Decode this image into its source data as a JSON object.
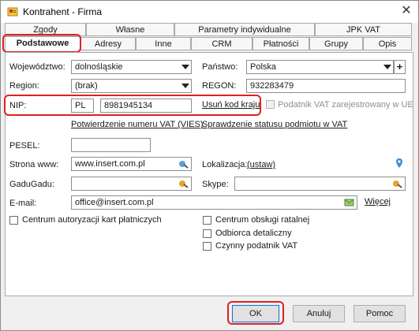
{
  "window": {
    "title": "Kontrahent - Firma"
  },
  "tabs_top": [
    {
      "label": "Zgody"
    },
    {
      "label": "Własne"
    },
    {
      "label": "Parametry indywidualne"
    },
    {
      "label": "JPK VAT"
    }
  ],
  "tabs_bottom": [
    {
      "label": "Podstawowe",
      "active": true
    },
    {
      "label": "Adresy"
    },
    {
      "label": "Inne"
    },
    {
      "label": "CRM"
    },
    {
      "label": "Płatności"
    },
    {
      "label": "Grupy"
    },
    {
      "label": "Opis"
    }
  ],
  "form": {
    "wojewodztwo_label": "Województwo:",
    "wojewodztwo_value": "dolnośląskie",
    "panstwo_label": "Państwo:",
    "panstwo_value": "Polska",
    "panstwo_add": "+",
    "region_label": "Region:",
    "region_value": "(brak)",
    "regon_label": "REGON:",
    "regon_value": "932283479",
    "nip_label": "NIP:",
    "nip_prefix": "PL",
    "nip_value": "8981945134",
    "usun_kod_kraju": "Usuń kod kraju",
    "podatnik_vat_ue": "Podatnik VAT zarejestrowany w UE",
    "potwierdzenie_vies": "Potwierdzenie numeru VAT (VIES)",
    "sprawdzenie_vat": "Sprawdzenie statusu podmiotu w VAT",
    "pesel_label": "PESEL:",
    "pesel_value": "",
    "strona_label": "Strona www:",
    "strona_value": "www.insert.com.pl",
    "lokalizacja_label": "Lokalizacja:",
    "lokalizacja_link": "(ustaw)",
    "gadugadu_label": "GaduGadu:",
    "gadugadu_value": "",
    "skype_label": "Skype:",
    "skype_value": "",
    "email_label": "E-mail:",
    "email_value": "office@insert.com.pl",
    "wiecej": "Więcej"
  },
  "checkboxes": {
    "centrum_autoryzacji": "Centrum autoryzacji kart płatniczych",
    "centrum_obslugi": "Centrum obsługi ratalnej",
    "odbiorca_detaliczny": "Odbiorca detaliczny",
    "czynny_podatnik": "Czynny podatnik VAT"
  },
  "buttons": {
    "ok": "OK",
    "anuluj": "Anuluj",
    "pomoc": "Pomoc"
  },
  "colors": {
    "highlight": "#e02020",
    "accent": "#0078d7"
  }
}
